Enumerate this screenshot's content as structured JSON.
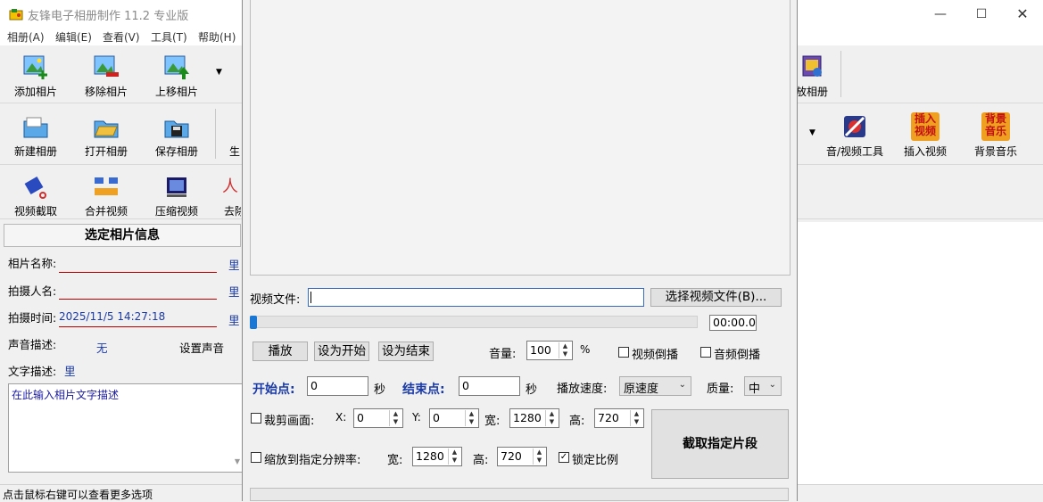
{
  "window": {
    "title": "友锋电子相册制作 11.2 专业版"
  },
  "menu": [
    "相册(A)",
    "编辑(E)",
    "查看(V)",
    "工具(T)",
    "帮助(H)"
  ],
  "toolbar": {
    "row1": [
      "添加相片",
      "移除相片",
      "上移相片"
    ],
    "row1_right": "放相册",
    "row2": [
      "新建相册",
      "打开相册",
      "保存相册",
      "生"
    ],
    "row2_right": [
      "音/视频工具",
      "插入视频",
      "背景音乐"
    ],
    "row3": [
      "视频截取",
      "合并视频",
      "压缩视频",
      "去除"
    ]
  },
  "icon_texts": {
    "insert_video": "插入\n视频",
    "bg_music": "背景\n音乐"
  },
  "info": {
    "header": "选定相片信息",
    "name_label": "相片名称:",
    "photographer_label": "拍摄人名:",
    "time_label": "拍摄时间:",
    "time_value": "2025/11/5 14:27:18",
    "side_char": "里",
    "sound_label": "声音描述:",
    "sound_value": "无",
    "set_sound": "设置声音",
    "text_label": "文字描述:",
    "text_side": "里",
    "desc_placeholder": "在此输入相片文字描述"
  },
  "status": "点击鼠标右键可以查看更多选项",
  "dialog": {
    "video_file_label": "视频文件:",
    "video_file_value": "",
    "choose_button": "选择视频文件(B)...",
    "time_display": "00:00.0",
    "progress": 0,
    "play_button": "播放",
    "set_start_button": "设为开始",
    "set_end_button": "设为结束",
    "volume_label": "音量:",
    "volume_value": "100",
    "percent": "%",
    "video_reverse": "视频倒播",
    "audio_reverse": "音频倒播",
    "start_label": "开始点:",
    "start_value": "0",
    "seconds": "秒",
    "end_label": "结束点:",
    "end_value": "0",
    "speed_label": "播放速度:",
    "speed_value": "原速度",
    "quality_label": "质量:",
    "quality_value": "中",
    "crop_label": "裁剪画面:",
    "x_label": "X:",
    "x_value": "0",
    "y_label": "Y:",
    "y_value": "0",
    "w_label": "宽:",
    "w_value": "1280",
    "h_label": "高:",
    "h_value": "720",
    "scale_label": "缩放到指定分辨率:",
    "sw_label": "宽:",
    "sw_value": "1280",
    "sh_label": "高:",
    "sh_value": "720",
    "lock_ratio": "锁定比例",
    "lock_checked": true,
    "cut_button": "截取指定片段"
  }
}
